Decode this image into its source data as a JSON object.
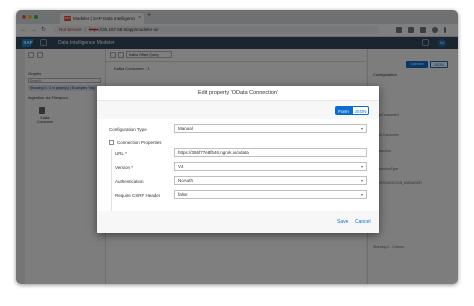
{
  "browser": {
    "tab_title": "Modeler | SAP Data Intelligence",
    "tab_favicon": "SAP",
    "tab_close": "×",
    "new_tab": "+",
    "not_secure": "Not Secure",
    "url_scheme": "https",
    "url_rest": "://35.187.68.5/app/modeler-ui/",
    "back": "←",
    "forward": "→",
    "reload": "↻"
  },
  "app": {
    "logo": "SAP",
    "title": "Data Intelligence Modeler",
    "avatar": "SA"
  },
  "left_panel": {
    "header": "Graphs",
    "search_placeholder": "Search",
    "filter_text": "Showing 2 / 2 in graph(s) | Examples \"http\" a/c",
    "graph_item": "Ingestion via Filespool",
    "operator_label": "Kafka Consumer"
  },
  "toolbar": {
    "graph_select": "Kafka Offset Query"
  },
  "canvas": {
    "tab_label": "Kafka Consumer - 1"
  },
  "right_panel": {
    "btn_generic": "Operator",
    "btn_json": "JSON",
    "title": "Configuration",
    "rows": [
      "kafkaConsumer1",
      "Kafka Consumer",
      "Connection",
      "ConnectionType",
      "CONFIGURATION_MANAGER",
      "Showing 0 - 0 items"
    ]
  },
  "dialog": {
    "title": "Edit property 'OData Connection'",
    "toggle_form": "Form",
    "toggle_json": "JSON",
    "fields": {
      "config_type_label": "Configuration Type",
      "config_type_value": "Manual",
      "connection_props_label": "Connection Properties",
      "url_label": "URL *",
      "url_value": "https://356f77e8fb46.ngrok.io/odata",
      "version_label": "Version *",
      "version_value": "V4",
      "auth_label": "Authentication",
      "auth_value": "NoAuth",
      "csrf_label": "Require CSRF Header",
      "csrf_value": "false"
    },
    "save": "Save",
    "cancel": "Cancel"
  },
  "colors": {
    "shell": "#354a5f",
    "accent": "#0a6ed1",
    "sap_logo": "#1b84d1"
  }
}
